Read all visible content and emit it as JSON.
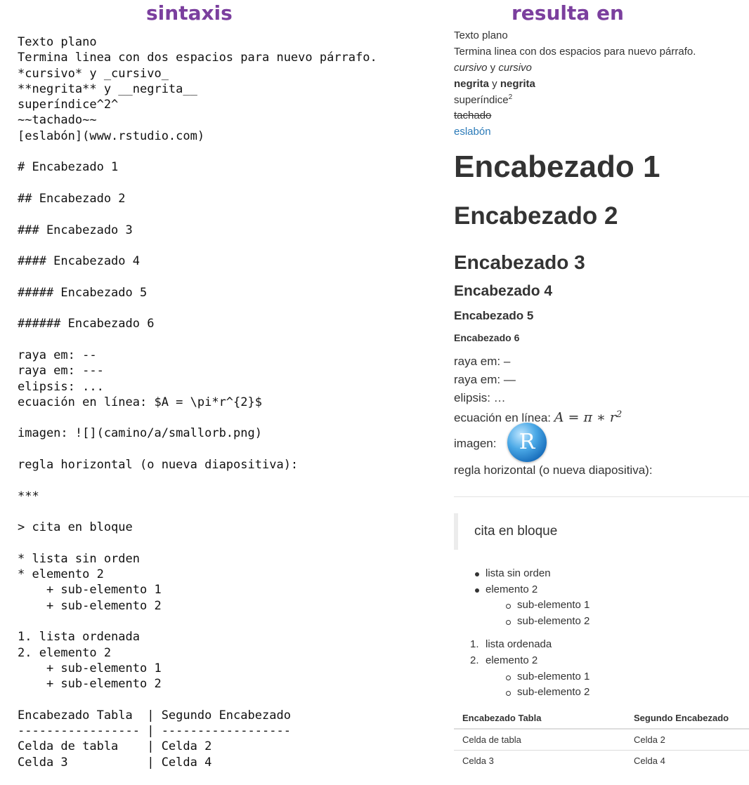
{
  "headers": {
    "left": "sintaxis",
    "right": "resulta en"
  },
  "syntax_lines": [
    "Texto plano",
    "Termina linea con dos espacios para nuevo párrafo.",
    "*cursivo* y _cursivo_",
    "**negrita** y __negrita__",
    "superíndice^2^",
    "~~tachado~~",
    "[eslabón](www.rstudio.com)",
    "",
    "# Encabezado 1",
    "",
    "## Encabezado 2",
    "",
    "### Encabezado 3",
    "",
    "#### Encabezado 4",
    "",
    "##### Encabezado 5",
    "",
    "###### Encabezado 6",
    "",
    "raya em: --",
    "raya em: ---",
    "elipsis: ...",
    "ecuación en línea: $A = \\pi*r^{2}$",
    "",
    "imagen: ![](camino/a/smallorb.png)",
    "",
    "regla horizontal (o nueva diapositiva):",
    "",
    "***",
    "",
    "> cita en bloque",
    "",
    "* lista sin orden",
    "* elemento 2",
    "    + sub-elemento 1",
    "    + sub-elemento 2",
    "",
    "1. lista ordenada",
    "2. elemento 2",
    "    + sub-elemento 1",
    "    + sub-elemento 2",
    "",
    "Encabezado Tabla  | Segundo Encabezado",
    "----------------- | ------------------",
    "Celda de tabla    | Celda 2",
    "Celda 3           | Celda 4"
  ],
  "result": {
    "plain": "Texto plano",
    "paragraph": "Termina linea con dos espacios para nuevo párrafo.",
    "italic1": "cursivo",
    "italic_join": " y ",
    "italic2": "cursivo",
    "bold1": "negrita",
    "bold_join": " y ",
    "bold2": "negrita",
    "superscript_base": "superíndice",
    "superscript_exp": "2",
    "strike": "tachado",
    "link": "eslabón",
    "h1": "Encabezado 1",
    "h2": "Encabezado 2",
    "h3": "Encabezado 3",
    "h4": "Encabezado 4",
    "h5": "Encabezado 5",
    "h6": "Encabezado 6",
    "en_dash": "raya em: –",
    "em_dash": "raya em: —",
    "ellipsis": "elipsis: …",
    "equation_label": "ecuación en línea: ",
    "equation": "A = π ∗ r",
    "equation_exp": "2",
    "image_label": "imagen:",
    "image_logo_letter": "R",
    "rule_label": "regla horizontal (o nueva diapositiva):",
    "blockquote": "cita en bloque",
    "unordered": [
      "lista sin orden",
      "elemento 2"
    ],
    "unordered_sub": [
      "sub-elemento 1",
      "sub-elemento 2"
    ],
    "ordered_markers": [
      "1.",
      "2."
    ],
    "ordered": [
      "lista ordenada",
      "elemento 2"
    ],
    "ordered_sub": [
      "sub-elemento 1",
      "sub-elemento 2"
    ],
    "table": {
      "headers": [
        "Encabezado Tabla",
        "Segundo Encabezado"
      ],
      "rows": [
        [
          "Celda de tabla",
          "Celda 2"
        ],
        [
          "Celda 3",
          "Celda 4"
        ]
      ]
    }
  },
  "colors": {
    "header": "#7b3f9e",
    "link": "#2a7ab8",
    "text": "#333333"
  }
}
